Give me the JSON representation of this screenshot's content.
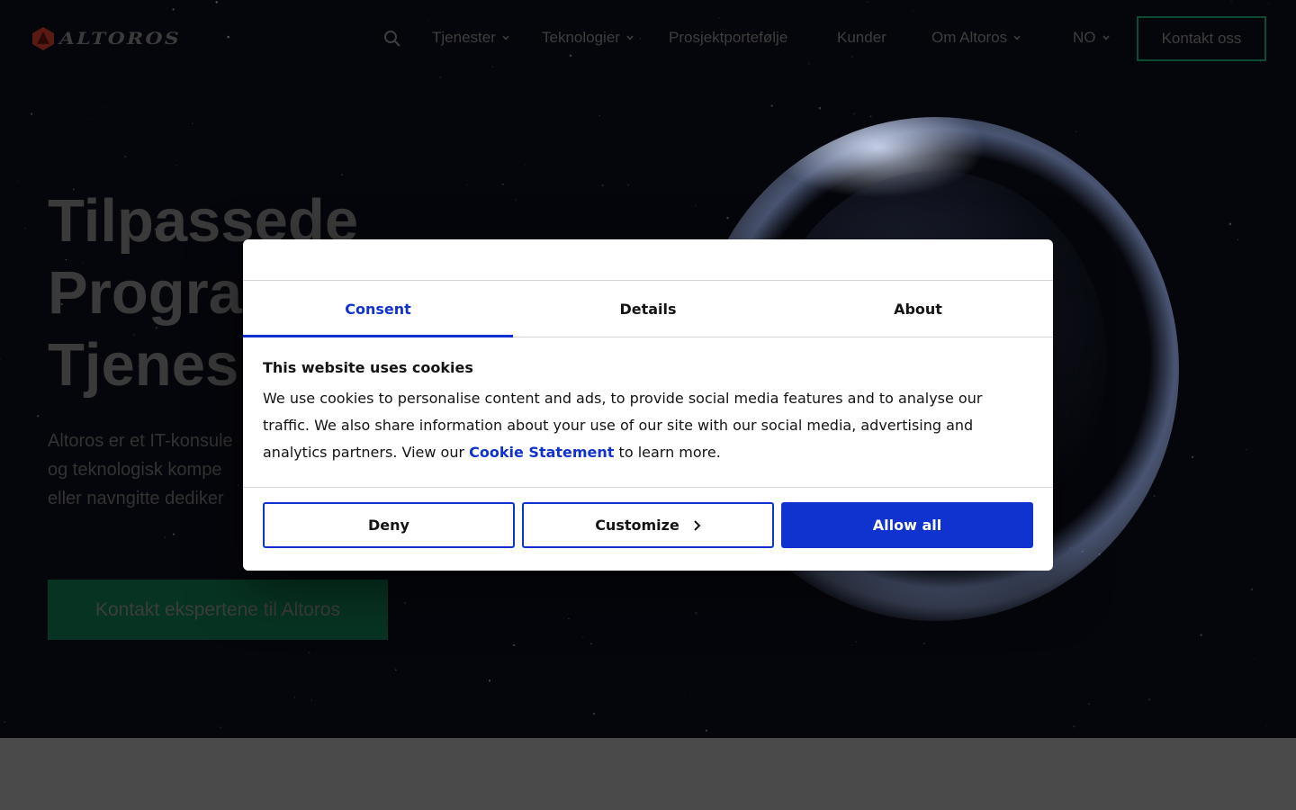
{
  "header": {
    "logo_text": "ALTOROS",
    "nav": [
      {
        "label": "Tjenester"
      },
      {
        "label": "Teknologier"
      },
      {
        "label": "Prosjektportefølje"
      },
      {
        "label": "Kunder"
      },
      {
        "label": "Om Altoros"
      },
      {
        "label": "NO"
      }
    ],
    "contact_label": "Kontakt oss"
  },
  "hero": {
    "title_lines": [
      "Tilpassede",
      "Progra",
      "Tjenes"
    ],
    "desc_lines": [
      "Altoros er et IT-konsule",
      "og teknologisk kompe",
      "eller navngitte dediker"
    ],
    "cta_label": "Kontakt ekspertene til Altoros"
  },
  "dialog": {
    "tabs": [
      {
        "label": "Consent",
        "active": true
      },
      {
        "label": "Details",
        "active": false
      },
      {
        "label": "About",
        "active": false
      }
    ],
    "title": "This website uses cookies",
    "text_line1": "We use cookies to personalise content and ads, to provide social media features and to analyse our",
    "text_line2": "traffic. We also share information about your use of our site with our social media, advertising and",
    "text_line3_pre": "analytics partners. View our ",
    "link_label": "Cookie Statement",
    "text_line3_post": " to learn more.",
    "buttons": {
      "deny": "Deny",
      "customize": "Customize",
      "allow": "Allow all"
    }
  },
  "colors": {
    "accent": "#1032cf",
    "brand_green": "#073422",
    "logo_red": "#c0392b"
  }
}
